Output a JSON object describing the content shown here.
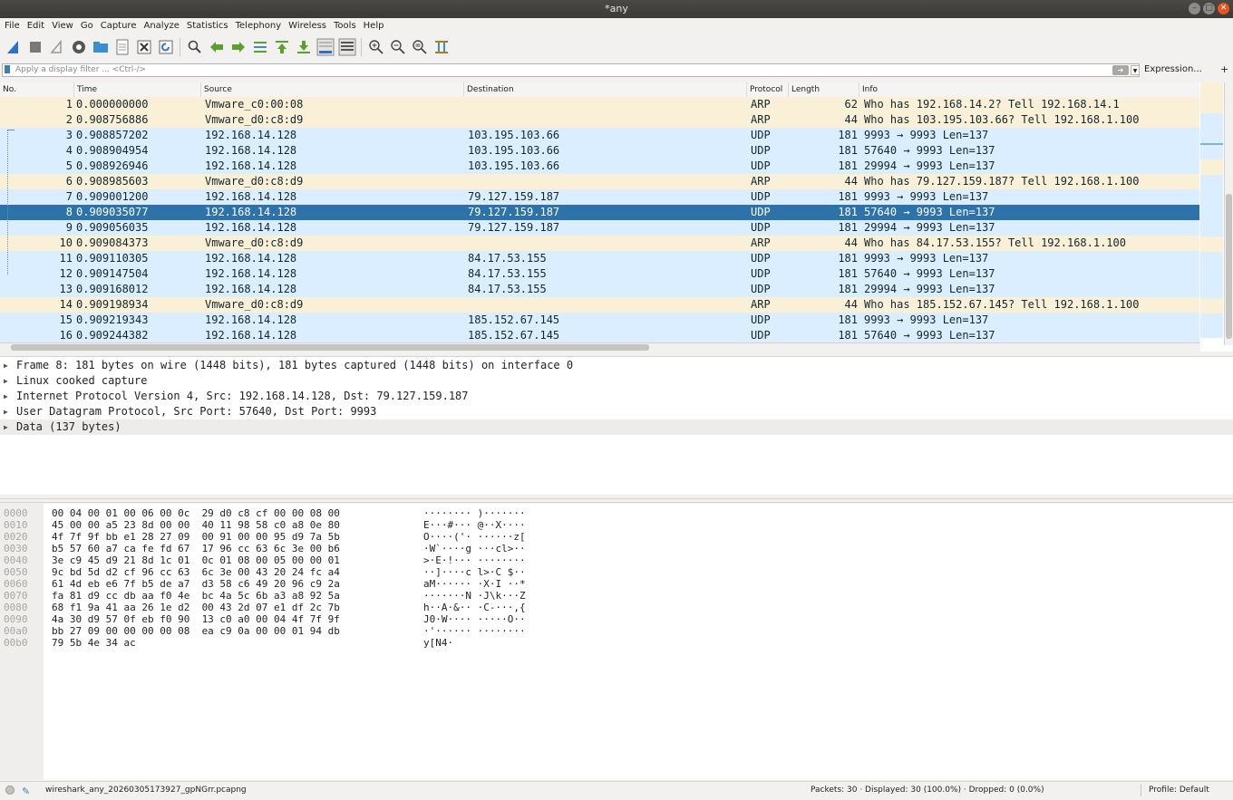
{
  "window": {
    "title": "*any"
  },
  "menu": [
    "File",
    "Edit",
    "View",
    "Go",
    "Capture",
    "Analyze",
    "Statistics",
    "Telephony",
    "Wireless",
    "Tools",
    "Help"
  ],
  "filter": {
    "placeholder": "Apply a display filter ... <Ctrl-/>",
    "expression_label": "Expression...",
    "plus_label": "+"
  },
  "columns": {
    "no": "No.",
    "time": "Time",
    "source": "Source",
    "destination": "Destination",
    "protocol": "Protocol",
    "length": "Length",
    "info": "Info"
  },
  "packets": [
    {
      "no": "1",
      "time": "0.000000000",
      "src": "Vmware_c0:00:08",
      "dst": "",
      "proto": "ARP",
      "len": "62",
      "info": "Who has 192.168.14.2? Tell 192.168.14.1",
      "kind": "arp"
    },
    {
      "no": "2",
      "time": "0.908756886",
      "src": "Vmware_d0:c8:d9",
      "dst": "",
      "proto": "ARP",
      "len": "44",
      "info": "Who has 103.195.103.66? Tell 192.168.1.100",
      "kind": "arp"
    },
    {
      "no": "3",
      "time": "0.908857202",
      "src": "192.168.14.128",
      "dst": "103.195.103.66",
      "proto": "UDP",
      "len": "181",
      "info": "9993 → 9993 Len=137",
      "kind": "udp"
    },
    {
      "no": "4",
      "time": "0.908904954",
      "src": "192.168.14.128",
      "dst": "103.195.103.66",
      "proto": "UDP",
      "len": "181",
      "info": "57640 → 9993 Len=137",
      "kind": "udp"
    },
    {
      "no": "5",
      "time": "0.908926946",
      "src": "192.168.14.128",
      "dst": "103.195.103.66",
      "proto": "UDP",
      "len": "181",
      "info": "29994 → 9993 Len=137",
      "kind": "udp"
    },
    {
      "no": "6",
      "time": "0.908985603",
      "src": "Vmware_d0:c8:d9",
      "dst": "",
      "proto": "ARP",
      "len": "44",
      "info": "Who has 79.127.159.187? Tell 192.168.1.100",
      "kind": "arp"
    },
    {
      "no": "7",
      "time": "0.909001200",
      "src": "192.168.14.128",
      "dst": "79.127.159.187",
      "proto": "UDP",
      "len": "181",
      "info": "9993 → 9993 Len=137",
      "kind": "udp"
    },
    {
      "no": "8",
      "time": "0.909035077",
      "src": "192.168.14.128",
      "dst": "79.127.159.187",
      "proto": "UDP",
      "len": "181",
      "info": "57640 → 9993 Len=137",
      "kind": "sel"
    },
    {
      "no": "9",
      "time": "0.909056035",
      "src": "192.168.14.128",
      "dst": "79.127.159.187",
      "proto": "UDP",
      "len": "181",
      "info": "29994 → 9993 Len=137",
      "kind": "udp"
    },
    {
      "no": "10",
      "time": "0.909084373",
      "src": "Vmware_d0:c8:d9",
      "dst": "",
      "proto": "ARP",
      "len": "44",
      "info": "Who has 84.17.53.155? Tell 192.168.1.100",
      "kind": "arp"
    },
    {
      "no": "11",
      "time": "0.909110305",
      "src": "192.168.14.128",
      "dst": "84.17.53.155",
      "proto": "UDP",
      "len": "181",
      "info": "9993 → 9993 Len=137",
      "kind": "udp"
    },
    {
      "no": "12",
      "time": "0.909147504",
      "src": "192.168.14.128",
      "dst": "84.17.53.155",
      "proto": "UDP",
      "len": "181",
      "info": "57640 → 9993 Len=137",
      "kind": "udp"
    },
    {
      "no": "13",
      "time": "0.909168012",
      "src": "192.168.14.128",
      "dst": "84.17.53.155",
      "proto": "UDP",
      "len": "181",
      "info": "29994 → 9993 Len=137",
      "kind": "udp"
    },
    {
      "no": "14",
      "time": "0.909198934",
      "src": "Vmware_d0:c8:d9",
      "dst": "",
      "proto": "ARP",
      "len": "44",
      "info": "Who has 185.152.67.145? Tell 192.168.1.100",
      "kind": "arp"
    },
    {
      "no": "15",
      "time": "0.909219343",
      "src": "192.168.14.128",
      "dst": "185.152.67.145",
      "proto": "UDP",
      "len": "181",
      "info": "9993 → 9993 Len=137",
      "kind": "udp"
    },
    {
      "no": "16",
      "time": "0.909244382",
      "src": "192.168.14.128",
      "dst": "185.152.67.145",
      "proto": "UDP",
      "len": "181",
      "info": "57640 → 9993 Len=137",
      "kind": "udp"
    }
  ],
  "details": [
    "Frame 8: 181 bytes on wire (1448 bits), 181 bytes captured (1448 bits) on interface 0",
    "Linux cooked capture",
    "Internet Protocol Version 4, Src: 192.168.14.128, Dst: 79.127.159.187",
    "User Datagram Protocol, Src Port: 57640, Dst Port: 9993",
    "Data (137 bytes)"
  ],
  "bytes": [
    {
      "off": "0000",
      "hex": "00 04 00 01 00 06 00 0c  29 d0 c8 cf 00 00 08 00",
      "ascii": "········ )·······"
    },
    {
      "off": "0010",
      "hex": "45 00 00 a5 23 8d 00 00  40 11 98 58 c0 a8 0e 80",
      "ascii": "E···#··· @··X····"
    },
    {
      "off": "0020",
      "hex": "4f 7f 9f bb e1 28 27 09  00 91 00 00 95 d9 7a 5b",
      "ascii": "O····('· ······z["
    },
    {
      "off": "0030",
      "hex": "b5 57 60 a7 ca fe fd 67  17 96 cc 63 6c 3e 00 b6",
      "ascii": "·W`····g ···cl>··"
    },
    {
      "off": "0040",
      "hex": "3e c9 45 d9 21 8d 1c 01  0c 01 08 00 05 00 00 01",
      "ascii": ">·E·!··· ········"
    },
    {
      "off": "0050",
      "hex": "9c bd 5d d2 cf 96 cc 63  6c 3e 00 43 20 24 fc a4",
      "ascii": "··]····c l>·C $··"
    },
    {
      "off": "0060",
      "hex": "61 4d eb e6 7f b5 de a7  d3 58 c6 49 20 96 c9 2a",
      "ascii": "aM······ ·X·I ··*"
    },
    {
      "off": "0070",
      "hex": "fa 81 d9 cc db aa f0 4e  bc 4a 5c 6b a3 a8 92 5a",
      "ascii": "·······N ·J\\k···Z"
    },
    {
      "off": "0080",
      "hex": "68 f1 9a 41 aa 26 1e d2  00 43 2d 07 e1 df 2c 7b",
      "ascii": "h··A·&·· ·C-···,{"
    },
    {
      "off": "0090",
      "hex": "4a 30 d9 57 0f eb f0 90  13 c0 a0 00 04 4f 7f 9f",
      "ascii": "J0·W···· ·····O··"
    },
    {
      "off": "00a0",
      "hex": "bb 27 09 00 00 00 00 08  ea c9 0a 00 00 01 94 db",
      "ascii": "·'······ ········"
    },
    {
      "off": "00b0",
      "hex": "79 5b 4e 34 ac",
      "ascii": "y[N4·"
    }
  ],
  "status": {
    "file": "wireshark_any_20260305173927_gpNGrr.pcapng",
    "packets": "Packets: 30 · Displayed: 30 (100.0%) · Dropped: 0 (0.0%)",
    "profile": "Profile: Default"
  }
}
